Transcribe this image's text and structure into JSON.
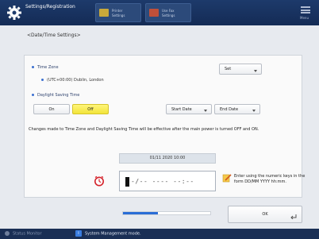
{
  "header": {
    "title": "Settings/Registration",
    "btn1_label": "Printer Settings",
    "btn2_label": "Use Fax Settings",
    "menu_label": "Menu",
    "accent": "#1d3a6b"
  },
  "breadcrumb": "<Date/Time Settings>",
  "time_zone": {
    "label": "Time Zone",
    "value": "(UTC+00:00) Dublin, London",
    "set_button": "Set"
  },
  "dst": {
    "label": "Daylight Saving Time",
    "on_label": "On",
    "off_label": "Off",
    "selected": "Off",
    "start_date": "Start Date",
    "end_date": "End Date"
  },
  "notice": "Changes made to Time Zone and Daylight Saving Time will be effective after the main power is turned OFF and ON.",
  "datetime": {
    "current": "01/11 2020 10:00",
    "input_text": "-/-- ---- --:--",
    "hint": "Enter using the numeric keys in the form DD/MM YYYY hh:mm."
  },
  "progress_fraction": 0.4,
  "ok_label": "OK",
  "status_bar": {
    "monitor": "Status Monitor",
    "mode": "System Management mode."
  },
  "icons": {
    "gear": "gear-icon",
    "warning": "alarm-clock-icon",
    "hint": "pencil-note-icon"
  }
}
